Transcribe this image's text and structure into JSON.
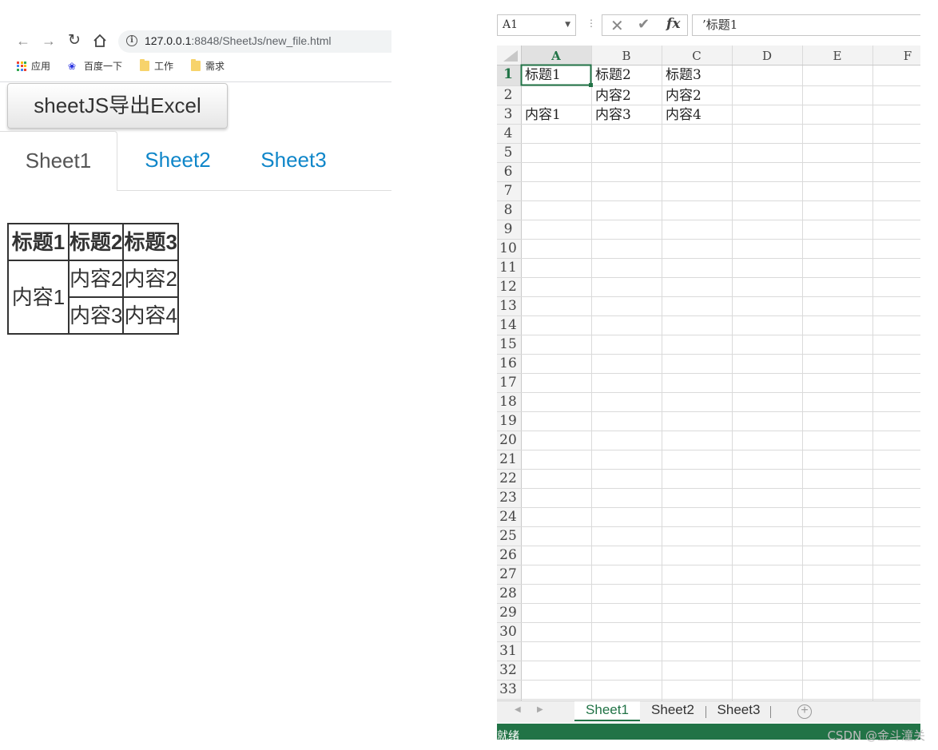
{
  "browser": {
    "url_host": "127.0.0.1",
    "url_path": ":8848/SheetJs/new_file.html",
    "bookmarks": [
      {
        "label": "应用",
        "icon": "apps-grid-icon"
      },
      {
        "label": "百度一下",
        "icon": "baidu-paw-icon"
      },
      {
        "label": "工作",
        "icon": "folder-icon"
      },
      {
        "label": "需求",
        "icon": "folder-icon"
      }
    ]
  },
  "page": {
    "export_button": "sheetJS导出Excel",
    "tabs": [
      "Sheet1",
      "Sheet2",
      "Sheet3"
    ],
    "active_tab": "Sheet1",
    "table": {
      "headers": [
        "标题1",
        "标题2",
        "标题3"
      ],
      "rowspan_cell": "内容1",
      "rows": [
        [
          "内容2",
          "内容2"
        ],
        [
          "内容3",
          "内容4"
        ]
      ]
    },
    "link_color": "#0f86c9"
  },
  "excel": {
    "name_box": "A1",
    "formula": "’标题1",
    "columns": [
      "A",
      "B",
      "C",
      "D",
      "E",
      "F"
    ],
    "selected_cell": "A1",
    "row_count": 33,
    "cells": [
      {
        "row": 1,
        "col": "A",
        "text": "标题1"
      },
      {
        "row": 1,
        "col": "B",
        "text": "标题2"
      },
      {
        "row": 1,
        "col": "C",
        "text": "标题3"
      },
      {
        "row": 2,
        "col": "B",
        "text": "内容2"
      },
      {
        "row": 2,
        "col": "C",
        "text": "内容2"
      },
      {
        "row": 3,
        "col": "A",
        "text": "内容1"
      },
      {
        "row": 3,
        "col": "B",
        "text": "内容3"
      },
      {
        "row": 3,
        "col": "C",
        "text": "内容4"
      }
    ],
    "sheet_tabs": [
      "Sheet1",
      "Sheet2",
      "Sheet3"
    ],
    "active_sheet": "Sheet1",
    "status": "就绪",
    "accent_color": "#217346"
  },
  "watermark": "CSDN @金斗潼关"
}
